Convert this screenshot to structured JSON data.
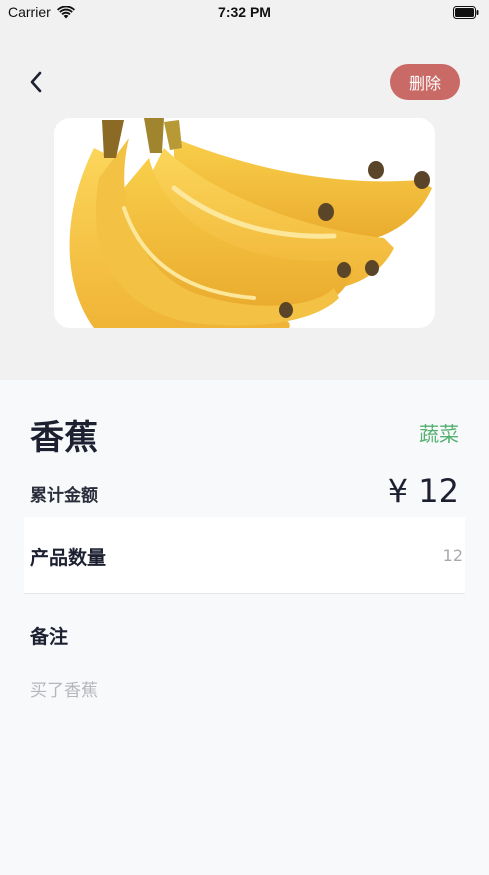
{
  "status_bar": {
    "carrier": "Carrier",
    "time": "7:32 PM"
  },
  "header": {
    "delete_label": "删除"
  },
  "product": {
    "name": "香蕉",
    "category": "蔬菜",
    "image": "banana-photo"
  },
  "amount": {
    "label": "累计金额",
    "value": "¥ 12"
  },
  "quantity": {
    "label": "产品数量",
    "value": "12"
  },
  "note": {
    "label": "备注",
    "value": "买了香蕉"
  },
  "colors": {
    "delete_button": "#c96a66",
    "category_text": "#55b070"
  }
}
